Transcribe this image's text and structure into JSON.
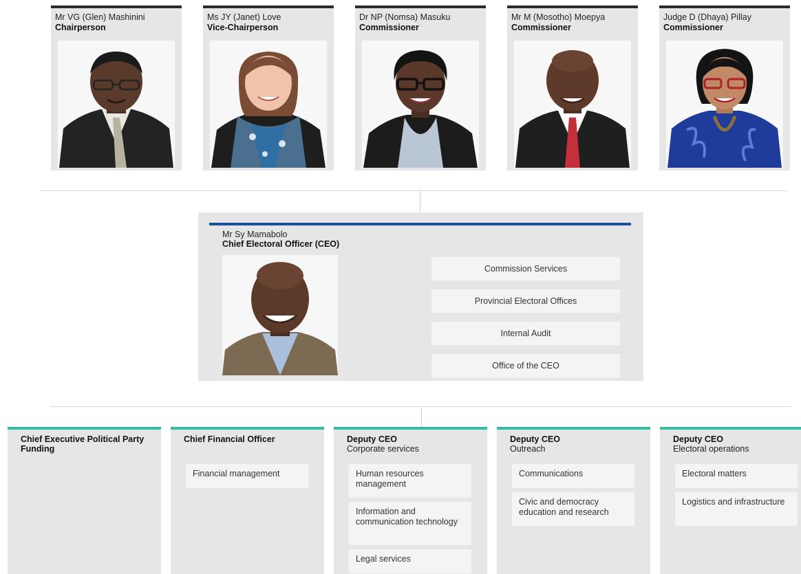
{
  "commissioners": [
    {
      "name": "Mr VG (Glen) Mashinini",
      "title": "Chairperson"
    },
    {
      "name": "Ms JY (Janet) Love",
      "title": "Vice-Chairperson"
    },
    {
      "name": "Dr NP (Nomsa) Masuku",
      "title": "Commissioner"
    },
    {
      "name": "Mr M (Mosotho) Moepya",
      "title": "Commissioner"
    },
    {
      "name": "Judge D (Dhaya) Pillay",
      "title": "Commissioner"
    }
  ],
  "ceo": {
    "name": "Mr Sy Mamabolo",
    "title": "Chief Electoral Officer (CEO)",
    "units": [
      "Commission Services",
      "Provincial Electoral Offices",
      "Internal Audit",
      "Office of the CEO"
    ]
  },
  "departments": [
    {
      "head": "Chief Executive Political Party Funding",
      "sub": "",
      "items": []
    },
    {
      "head": "Chief Financial Officer",
      "sub": "",
      "items": [
        "Financial management"
      ]
    },
    {
      "head": "Deputy CEO",
      "sub": "Corporate services",
      "items": [
        "Human resources management",
        "Information and communication technology",
        "Legal services"
      ]
    },
    {
      "head": "Deputy CEO",
      "sub": "Outreach",
      "items": [
        "Communications",
        "Civic and democracy education and research"
      ]
    },
    {
      "head": "Deputy CEO",
      "sub": "Electoral operations",
      "items": [
        "Electoral matters",
        "Logistics and infrastructure"
      ]
    }
  ],
  "colors": {
    "board_top": "#2b2b2b",
    "ceo_bar": "#1f4e9c",
    "dept_top": "#2ebfa5",
    "panel": "#e6e6e6"
  }
}
